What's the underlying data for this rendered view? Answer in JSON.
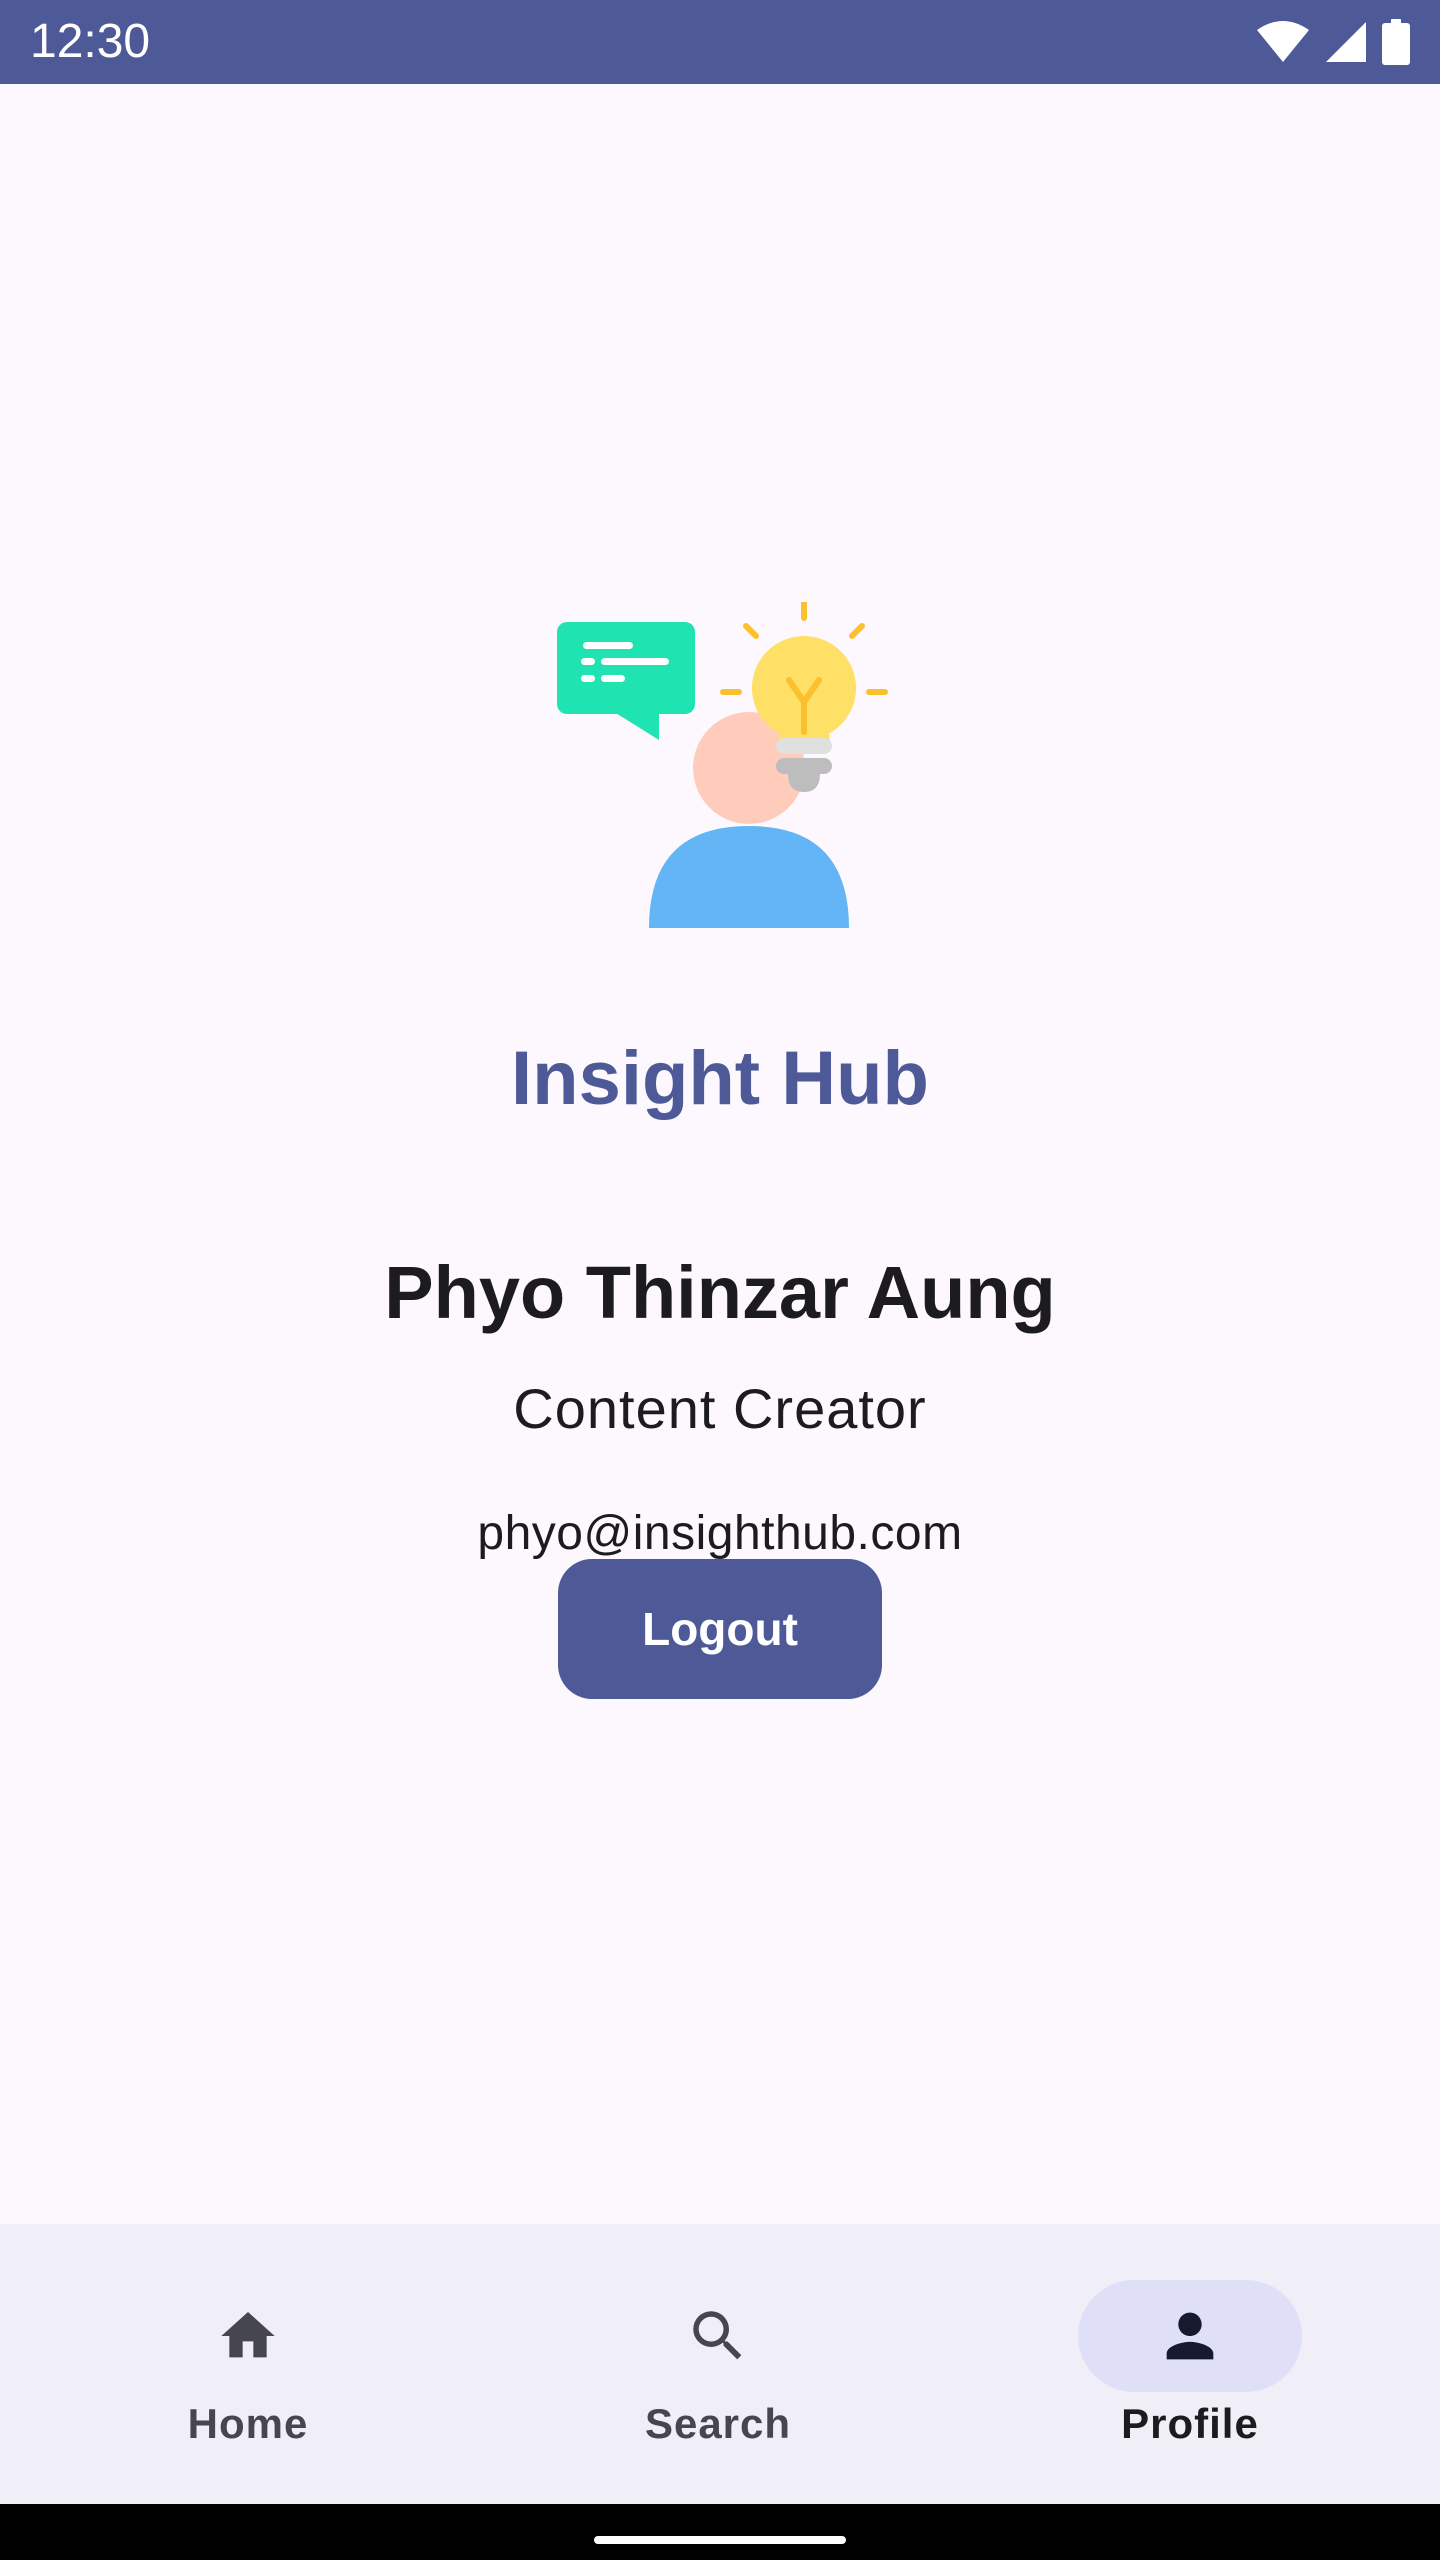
{
  "status_bar": {
    "time": "12:30",
    "background": "#4d5a97",
    "icons": [
      "wifi-icon",
      "cellular-signal-icon",
      "battery-icon"
    ]
  },
  "profile": {
    "app_name": "Insight Hub",
    "user_name": "Phyo Thinzar Aung",
    "role": "Content Creator",
    "email": "phyo@insighthub.com",
    "logout_label": "Logout",
    "logo_icon": "person-idea-icon"
  },
  "bottom_nav": {
    "selected": "Profile",
    "items": [
      {
        "label": "Home",
        "icon": "home-icon"
      },
      {
        "label": "Search",
        "icon": "search-icon"
      },
      {
        "label": "Profile",
        "icon": "person-icon"
      }
    ]
  },
  "colors": {
    "primary": "#4d5a97",
    "background": "#fcf8fd",
    "nav_background": "#f0eef6",
    "nav_indicator": "#dfe0f8",
    "text": "#1c1b1f"
  }
}
